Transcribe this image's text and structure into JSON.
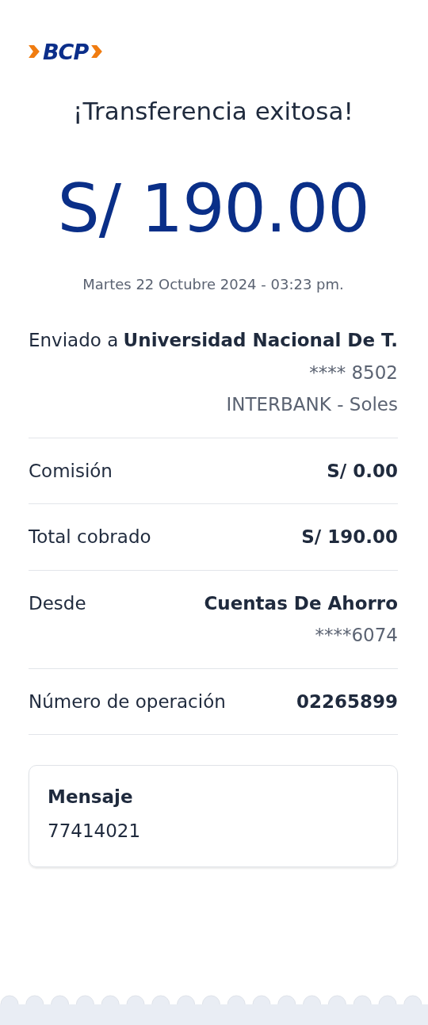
{
  "logo": {
    "text": "BCP"
  },
  "title": "¡Transferencia exitosa!",
  "amount": "S/ 190.00",
  "date": "Martes 22 Octubre 2024 - 03:23 pm.",
  "recipient": {
    "label": "Enviado a",
    "name": "Universidad Nacional De T.",
    "lines": [
      "**** 8502",
      "INTERBANK - Soles"
    ]
  },
  "details": [
    {
      "label": "Comisión",
      "value": "S/ 0.00"
    },
    {
      "label": "Total cobrado",
      "value": "S/ 190.00"
    },
    {
      "label": "Desde",
      "value": "Cuentas De Ahorro",
      "sub": "****6074"
    },
    {
      "label": "Número de operación",
      "value": "02265899"
    }
  ],
  "message": {
    "label": "Mensaje",
    "text": "77414021"
  }
}
